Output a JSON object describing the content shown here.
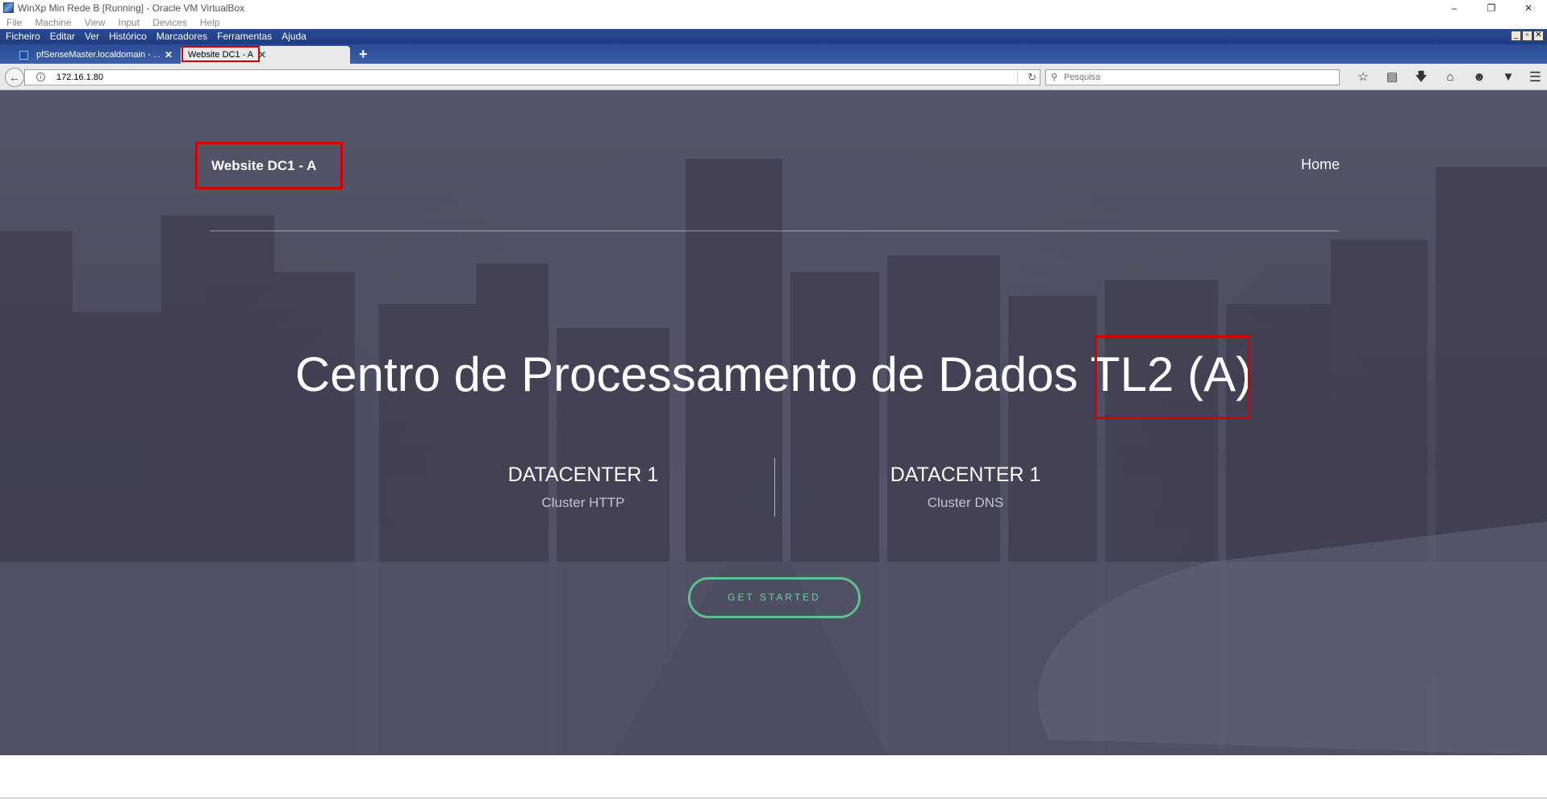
{
  "vbox": {
    "title": "WinXp Min Rede B [Running] - Oracle VM VirtualBox",
    "menu": [
      "File",
      "Machine",
      "View",
      "Input",
      "Devices",
      "Help"
    ],
    "window_controls": [
      "–",
      "❐",
      "✕"
    ]
  },
  "firefox": {
    "menu": [
      "Ficheiro",
      "Editar",
      "Ver",
      "Histórico",
      "Marcadores",
      "Ferramentas",
      "Ajuda"
    ],
    "guest_controls": [
      "_",
      "▫",
      "✕"
    ],
    "tabs": [
      {
        "label": "pfSenseMaster.localdomain - ...",
        "close": "✕"
      },
      {
        "label": "Website DC1 - A",
        "close": "✕"
      }
    ],
    "new_tab": "+",
    "url": "172.16.1.80",
    "search_placeholder": "Pesquisa",
    "toolbar_icons": [
      "star-icon",
      "clipboard-icon",
      "download-icon",
      "home-icon",
      "smiley-icon",
      "pocket-icon",
      "menu-icon"
    ]
  },
  "page": {
    "brand": "Website DC1 - A",
    "nav_home": "Home",
    "headline": "Centro de Processamento de Dados TL2 (A)",
    "columns": [
      {
        "title": "DATACENTER 1",
        "subtitle": "Cluster HTTP"
      },
      {
        "title": "DATACENTER 1",
        "subtitle": "Cluster DNS"
      }
    ],
    "cta": "GET STARTED"
  },
  "colors": {
    "highlight_box": "#d40000",
    "cta_green": "#5ec08e",
    "menubar_blue": "#2a4a93"
  }
}
